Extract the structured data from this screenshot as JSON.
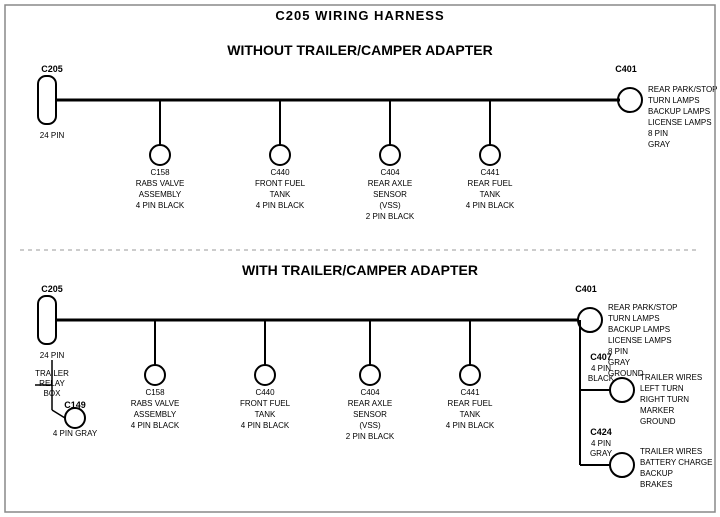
{
  "title": "C205 WIRING HARNESS",
  "section1": {
    "label": "WITHOUT TRAILER/CAMPER ADAPTER",
    "left_connector": {
      "name": "C205",
      "pins": "24 PIN"
    },
    "right_connector": {
      "name": "C401",
      "pins": "8 PIN",
      "color": "GRAY",
      "desc": "REAR PARK/STOP\nTURN LAMPS\nBACKUP LAMPS\nLICENSE LAMPS"
    },
    "connectors": [
      {
        "name": "C158",
        "desc": "RABS VALVE\nASSEMBLY\n4 PIN BLACK"
      },
      {
        "name": "C440",
        "desc": "FRONT FUEL\nTANK\n4 PIN BLACK"
      },
      {
        "name": "C404",
        "desc": "REAR AXLE\nSENSOR\n(VSS)\n2 PIN BLACK"
      },
      {
        "name": "C441",
        "desc": "REAR FUEL\nTANK\n4 PIN BLACK"
      }
    ]
  },
  "section2": {
    "label": "WITH TRAILER/CAMPER ADAPTER",
    "left_connector": {
      "name": "C205",
      "pins": "24 PIN"
    },
    "right_connector": {
      "name": "C401",
      "pins": "8 PIN",
      "color": "GRAY",
      "desc": "REAR PARK/STOP\nTURN LAMPS\nBACKUP LAMPS\nLICENSE LAMPS\nGROUND"
    },
    "trailer_relay": {
      "name": "TRAILER\nRELAY\nBOX"
    },
    "c149": {
      "name": "C149",
      "desc": "4 PIN GRAY"
    },
    "connectors": [
      {
        "name": "C158",
        "desc": "RABS VALVE\nASSEMBLY\n4 PIN BLACK"
      },
      {
        "name": "C440",
        "desc": "FRONT FUEL\nTANK\n4 PIN BLACK"
      },
      {
        "name": "C404",
        "desc": "REAR AXLE\nSENSOR\n(VSS)\n2 PIN BLACK"
      },
      {
        "name": "C441",
        "desc": "REAR FUEL\nTANK\n4 PIN BLACK"
      }
    ],
    "right_connectors": [
      {
        "name": "C407",
        "desc": "TRAILER WIRES\nLEFT TURN\nRIGHT TURN\nMARKER\nGROUND",
        "pins": "4 PIN\nBLACK"
      },
      {
        "name": "C424",
        "desc": "TRAILER WIRES\nBATTERY CHARGE\nBACKUP\nBRAKES",
        "pins": "4 PIN\nGRAY"
      }
    ]
  }
}
